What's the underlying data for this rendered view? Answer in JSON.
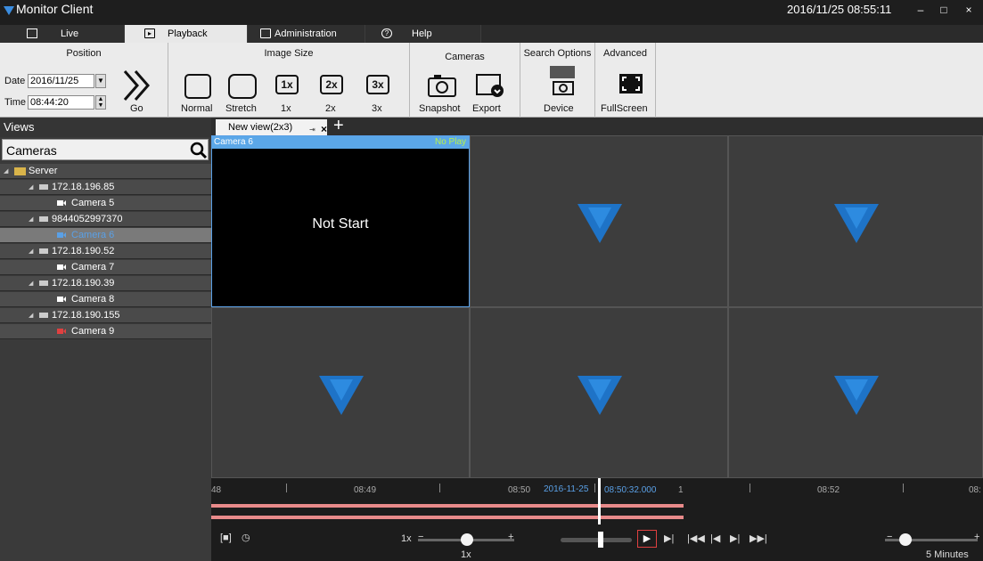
{
  "window": {
    "title": "Monitor Client",
    "clock": "2016/11/25 08:55:11",
    "minimize": "–",
    "maximize": "□",
    "close": "×"
  },
  "top_tabs": [
    {
      "label": "Live"
    },
    {
      "label": "Playback"
    },
    {
      "label": "Administration"
    },
    {
      "label": "Help"
    }
  ],
  "ribbon": {
    "position": {
      "header": "Position",
      "date_label": "Date",
      "date_value": "2016/11/25",
      "time_label": "Time",
      "time_value": "08:44:20",
      "go_label": "Go"
    },
    "image_size": {
      "header": "Image Size",
      "normal": "Normal",
      "stretch": "Stretch",
      "x1": "1x",
      "x2": "2x",
      "x3": "3x",
      "icon_1x": "1x",
      "icon_2x": "2x",
      "icon_3x": "3x"
    },
    "cameras": {
      "header": "Cameras",
      "snapshot": "Snapshot",
      "export": "Export"
    },
    "search_options": {
      "header": "Search Options",
      "device": "Device"
    },
    "advanced": {
      "header": "Advanced",
      "fullscreen": "FullScreen"
    }
  },
  "views": {
    "title": "Views",
    "search_value": "Cameras",
    "tree": [
      {
        "label": "Server",
        "type": "server"
      },
      {
        "label": "172.18.196.85",
        "type": "device"
      },
      {
        "label": "Camera 5",
        "type": "camera"
      },
      {
        "label": "9844052997370",
        "type": "device"
      },
      {
        "label": "Camera 6",
        "type": "camera",
        "selected": true
      },
      {
        "label": "172.18.190.52",
        "type": "device"
      },
      {
        "label": "Camera 7",
        "type": "camera"
      },
      {
        "label": "172.18.190.39",
        "type": "device"
      },
      {
        "label": "Camera 8",
        "type": "camera"
      },
      {
        "label": "172.18.190.155",
        "type": "device"
      },
      {
        "label": "Camera 9",
        "type": "camera",
        "error": true
      }
    ]
  },
  "view_tab": {
    "label": "New view(2x3)",
    "close": "×",
    "add": "+"
  },
  "active_cell": {
    "camera": "Camera 6",
    "status": "No Play",
    "message": "Not Start"
  },
  "timeline": {
    "labels": [
      "48",
      "08:49",
      "08:50",
      "08:52",
      "08:"
    ],
    "current_date": "2016-11-25",
    "current_time": "08:50:32.000",
    "marker": "1"
  },
  "controls": {
    "speed_label": "1x",
    "speed_value": "1x",
    "minus": "−",
    "plus": "+",
    "interval": "5 Minutes"
  },
  "colors": {
    "accent": "#5aa0e6",
    "logo": "#1e73c7",
    "noplay": "#b9f24a",
    "record_bar": "#e88a8a"
  }
}
